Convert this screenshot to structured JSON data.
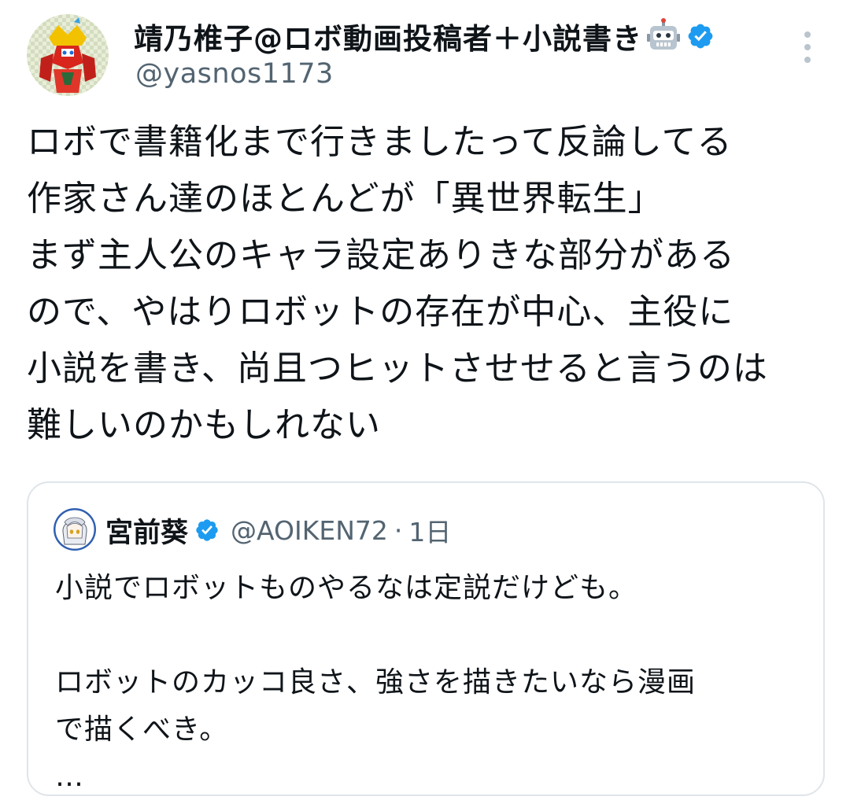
{
  "author": {
    "display_name": "靖乃椎子@ロボ動画投稿者＋小説書き",
    "handle": "@yasnos1173",
    "avatar": "robot-mecha-avatar",
    "verified_color": "#1d9bf0"
  },
  "tweet": {
    "text": "ロボで書籍化まで行きましたって反論してる\n作家さん達のほとんどが「異世界転生」\nまず主人公のキャラ設定ありきな部分がある\nので、やはりロボットの存在が中心、主役に\n小説を書き、尚且つヒットさせせると言うのは\n難しいのかもしれない"
  },
  "quote": {
    "display_name": "宮前葵",
    "handle": "@AOIKEN72",
    "separator": "·",
    "time": "1日",
    "text": "小説でロボットものやるなは定説だけども。\n\nロボットのカッコ良さ、強さを描きたいなら漫画\nで描くべき。\n…"
  },
  "colors": {
    "text": "#0f1419",
    "secondary": "#536471",
    "border": "#dfe5e9",
    "verified": "#1d9bf0"
  }
}
